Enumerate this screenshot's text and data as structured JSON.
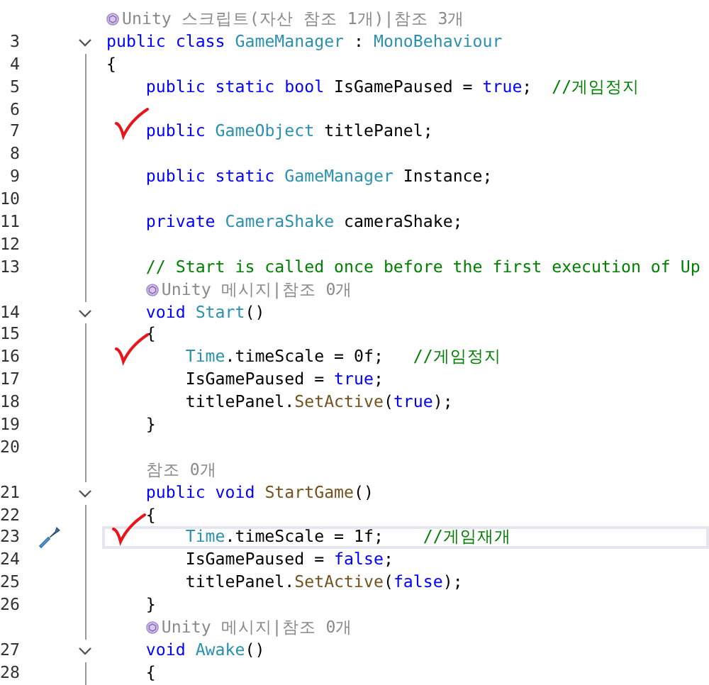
{
  "lines": [
    {
      "kind": "codelens",
      "unity_icon": true,
      "text": "Unity 스크립트(자산 참조 1개)|참조 3개"
    },
    {
      "kind": "code",
      "number": "3",
      "fold": true,
      "tokens": [
        {
          "kind": "keyword",
          "text": "public class "
        },
        {
          "kind": "type",
          "text": "GameManager"
        },
        {
          "kind": "plain",
          "text": " : "
        },
        {
          "kind": "type",
          "text": "MonoBehaviour"
        }
      ]
    },
    {
      "kind": "code",
      "number": "4",
      "tokens": [
        {
          "kind": "plain",
          "text": "{"
        }
      ]
    },
    {
      "kind": "code",
      "number": "5",
      "tokens": [
        {
          "kind": "keyword",
          "text": "    public static bool "
        },
        {
          "kind": "plain",
          "text": "IsGamePaused = "
        },
        {
          "kind": "keyword",
          "text": "true"
        },
        {
          "kind": "plain",
          "text": ";  "
        },
        {
          "kind": "comment",
          "text": "//게임정지"
        }
      ]
    },
    {
      "kind": "code",
      "number": "6"
    },
    {
      "kind": "code",
      "number": "7",
      "marked": true,
      "tokens": [
        {
          "kind": "keyword",
          "text": "    public "
        },
        {
          "kind": "type",
          "text": "GameObject"
        },
        {
          "kind": "plain",
          "text": " titlePanel;"
        }
      ]
    },
    {
      "kind": "code",
      "number": "8"
    },
    {
      "kind": "code",
      "number": "9",
      "tokens": [
        {
          "kind": "keyword",
          "text": "    public static "
        },
        {
          "kind": "type",
          "text": "GameManager"
        },
        {
          "kind": "plain",
          "text": " Instance;"
        }
      ]
    },
    {
      "kind": "code",
      "number": "10"
    },
    {
      "kind": "code",
      "number": "11",
      "tokens": [
        {
          "kind": "keyword",
          "text": "    private "
        },
        {
          "kind": "type",
          "text": "CameraShake"
        },
        {
          "kind": "plain",
          "text": " cameraShake;"
        }
      ]
    },
    {
      "kind": "code",
      "number": "12"
    },
    {
      "kind": "code",
      "number": "13",
      "tokens": [
        {
          "kind": "comment",
          "text": "    // Start is called once before the first execution of Up"
        }
      ]
    },
    {
      "kind": "codelens",
      "unity_icon": true,
      "text": "    Unity 메시지|참조 0개"
    },
    {
      "kind": "code",
      "number": "14",
      "fold": true,
      "tokens": [
        {
          "kind": "keyword",
          "text": "    void "
        },
        {
          "kind": "type",
          "text": "Start"
        },
        {
          "kind": "plain",
          "text": "()"
        }
      ]
    },
    {
      "kind": "code",
      "number": "15",
      "tokens": [
        {
          "kind": "plain",
          "text": "    {"
        }
      ]
    },
    {
      "kind": "code",
      "number": "16",
      "marked": true,
      "tokens": [
        {
          "kind": "type",
          "text": "        Time"
        },
        {
          "kind": "plain",
          "text": ".timeScale = 0f;   "
        },
        {
          "kind": "comment",
          "text": "//게임정지"
        }
      ]
    },
    {
      "kind": "code",
      "number": "17",
      "tokens": [
        {
          "kind": "plain",
          "text": "        IsGamePaused = "
        },
        {
          "kind": "keyword",
          "text": "true"
        },
        {
          "kind": "plain",
          "text": ";"
        }
      ]
    },
    {
      "kind": "code",
      "number": "18",
      "tokens": [
        {
          "kind": "plain",
          "text": "        titlePanel."
        },
        {
          "kind": "method",
          "text": "SetActive"
        },
        {
          "kind": "plain",
          "text": "("
        },
        {
          "kind": "keyword",
          "text": "true"
        },
        {
          "kind": "plain",
          "text": ");"
        }
      ]
    },
    {
      "kind": "code",
      "number": "19",
      "tokens": [
        {
          "kind": "plain",
          "text": "    }"
        }
      ]
    },
    {
      "kind": "code",
      "number": "20"
    },
    {
      "kind": "codelens",
      "unity_icon": false,
      "text": "    참조 0개"
    },
    {
      "kind": "code",
      "number": "21",
      "fold": true,
      "tokens": [
        {
          "kind": "keyword",
          "text": "    public void "
        },
        {
          "kind": "method",
          "text": "StartGame"
        },
        {
          "kind": "plain",
          "text": "()"
        }
      ]
    },
    {
      "kind": "code",
      "number": "22",
      "tokens": [
        {
          "kind": "plain",
          "text": "    {"
        }
      ]
    },
    {
      "kind": "code",
      "number": "23",
      "marked": true,
      "current": true,
      "quick_action": true,
      "tokens": [
        {
          "kind": "type",
          "text": "        Time"
        },
        {
          "kind": "plain",
          "text": ".timeScale = 1f;    "
        },
        {
          "kind": "comment",
          "text": "//게임재개"
        }
      ]
    },
    {
      "kind": "code",
      "number": "24",
      "tokens": [
        {
          "kind": "plain",
          "text": "        IsGamePaused = "
        },
        {
          "kind": "keyword",
          "text": "false"
        },
        {
          "kind": "plain",
          "text": ";"
        }
      ]
    },
    {
      "kind": "code",
      "number": "25",
      "tokens": [
        {
          "kind": "plain",
          "text": "        titlePanel."
        },
        {
          "kind": "method",
          "text": "SetActive"
        },
        {
          "kind": "plain",
          "text": "("
        },
        {
          "kind": "keyword",
          "text": "false"
        },
        {
          "kind": "plain",
          "text": ");"
        }
      ]
    },
    {
      "kind": "code",
      "number": "26",
      "tokens": [
        {
          "kind": "plain",
          "text": "    }"
        }
      ]
    },
    {
      "kind": "codelens",
      "unity_icon": true,
      "text": "    Unity 메시지|참조 0개"
    },
    {
      "kind": "code",
      "number": "27",
      "fold": true,
      "tokens": [
        {
          "kind": "keyword",
          "text": "    void "
        },
        {
          "kind": "type",
          "text": "Awake"
        },
        {
          "kind": "plain",
          "text": "()"
        }
      ]
    },
    {
      "kind": "code",
      "number": "28",
      "tokens": [
        {
          "kind": "plain",
          "text": "    {"
        }
      ]
    }
  ]
}
